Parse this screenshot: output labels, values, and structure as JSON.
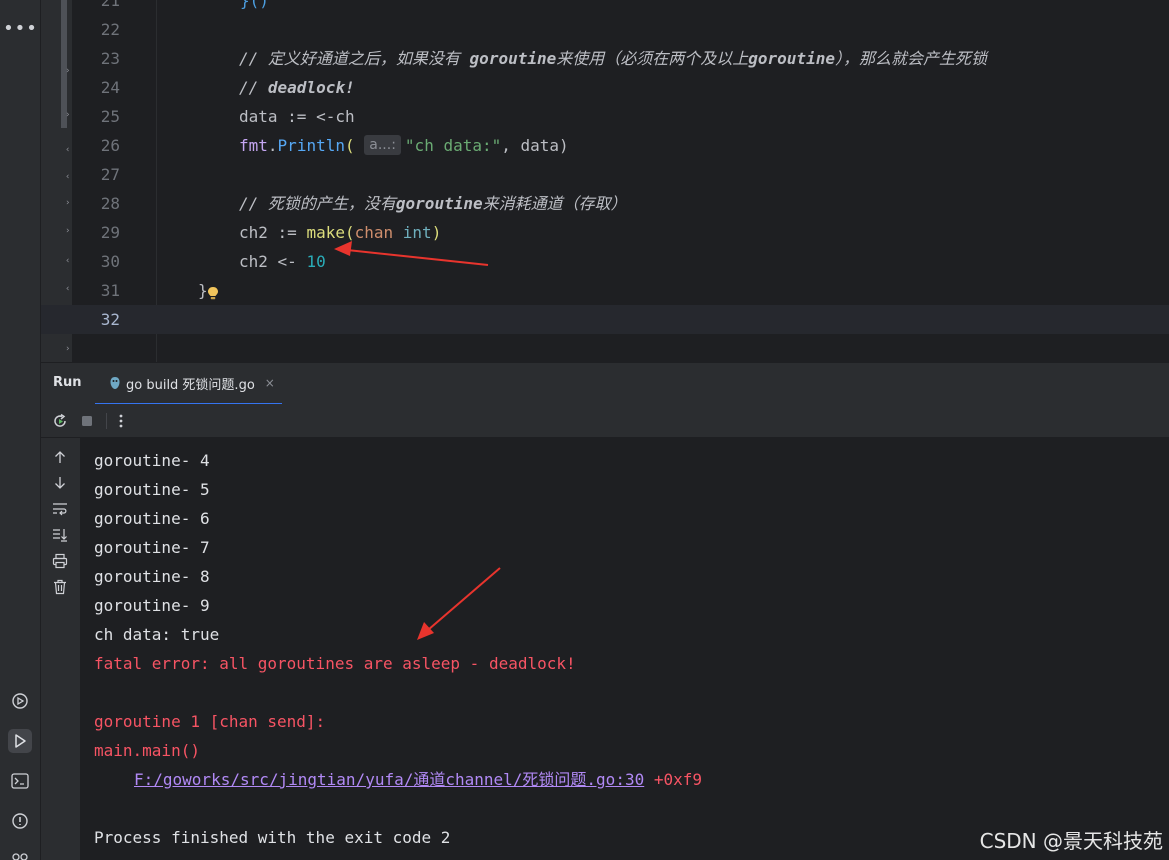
{
  "colors": {
    "background": "#1e1f22",
    "panel": "#2b2d30",
    "comment": "#4c9ee0",
    "error": "#f75464",
    "link": "#b189f5",
    "annotation_arrow": "#e8342d"
  },
  "activity_bar": {
    "more_label": "•••",
    "icons": [
      "services-icon",
      "run-icon",
      "terminal-icon",
      "problems-icon",
      "version-control-icon"
    ]
  },
  "editor": {
    "lines": [
      {
        "num": "21",
        "text": "}()"
      },
      {
        "num": "22",
        "text": ""
      },
      {
        "num": "23",
        "text": "// 定义好通道之后，如果没有 goroutine来使用（必须在两个及以上goroutine），那么就会产生死锁"
      },
      {
        "num": "24",
        "text": "// deadlock!"
      },
      {
        "num": "25",
        "text": "data := <-ch"
      },
      {
        "num": "26",
        "text": "fmt.Println( a...: \"ch data:\", data)"
      },
      {
        "num": "27",
        "text": ""
      },
      {
        "num": "28",
        "text": "// 死锁的产生，没有goroutine来消耗通道（存取）"
      },
      {
        "num": "29",
        "text": "ch2 := make(chan int)"
      },
      {
        "num": "30",
        "text": "ch2 <- 10"
      },
      {
        "num": "31",
        "text": "}"
      },
      {
        "num": "32",
        "text": ""
      }
    ],
    "tokens": {
      "l21_brace": "}()",
      "l23_a": "// 定义好通道之后，如果没有 ",
      "l23_b": "goroutine",
      "l23_c": "来使用（必须在两个及以上",
      "l23_d": "goroutine",
      "l23_e": "），那么就会产生死锁",
      "l24_a": "// ",
      "l24_b": "deadlock!",
      "l25": "data := <-ch",
      "l26_pkg": "fmt",
      "l26_dot": ".",
      "l26_fn": "Println",
      "l26_open": "(",
      "l26_hint": "a...:",
      "l26_str": "\"ch data:\"",
      "l26_rest": ", data)",
      "l28_a": "// 死锁的产生，没有",
      "l28_b": "goroutine",
      "l28_c": "来消耗通道（存取）",
      "l29_a": "ch2 := ",
      "l29_make": "make",
      "l29_open": "(",
      "l29_chan": "chan",
      "l29_sp": " ",
      "l29_int": "int",
      "l29_close": ")",
      "l30_a": "ch2 <- ",
      "l30_num": "10",
      "l31": "}"
    }
  },
  "run_panel": {
    "title": "Run",
    "tab_label": "go build 死锁问题.go",
    "tab_close": "×"
  },
  "console": {
    "partial_line": "9",
    "output": [
      "goroutine- 4",
      "goroutine- 5",
      "goroutine- 6",
      "goroutine- 7",
      "goroutine- 8",
      "goroutine- 9",
      "ch data: true"
    ],
    "fatal": "fatal error: all goroutines are asleep - deadlock!",
    "trace_header": "goroutine 1 [chan send]:",
    "trace_func": "main.main()",
    "trace_path": "F:/goworks/src/jingtian/yufa/通道channel/死锁问题.go:30",
    "trace_offset": " +0xf9",
    "exit": "Process finished with the exit code 2"
  },
  "watermark": "CSDN @景天科技苑"
}
